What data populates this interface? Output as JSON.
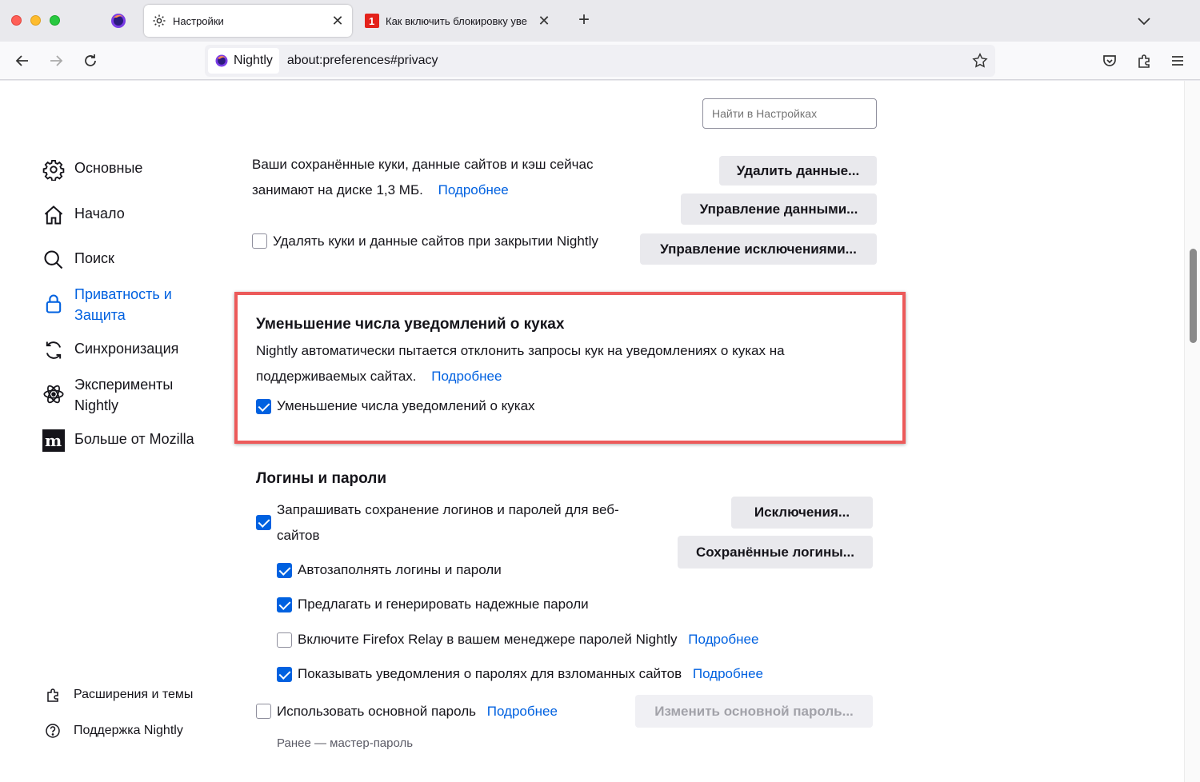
{
  "tabs": {
    "active_label": "Настройки",
    "inactive_label": "Как включить блокировку уве"
  },
  "urlbar": {
    "identity_label": "Nightly",
    "url": "about:preferences#privacy"
  },
  "search": {
    "placeholder": "Найти в Настройках"
  },
  "sidebar": {
    "items": [
      {
        "label": "Основные",
        "icon": "gear-icon"
      },
      {
        "label": "Начало",
        "icon": "home-icon"
      },
      {
        "label": "Поиск",
        "icon": "search-icon"
      },
      {
        "label": "Приватность и Защита",
        "icon": "lock-icon",
        "selected": true
      },
      {
        "label": "Синхронизация",
        "icon": "sync-icon"
      },
      {
        "label": "Эксперименты Nightly",
        "icon": "experiments-icon"
      },
      {
        "label": "Больше от Mozilla",
        "icon": "mozilla-icon"
      }
    ],
    "footer": {
      "extensions_label": "Расширения и темы",
      "support_label": "Поддержка Nightly"
    }
  },
  "cookies": {
    "usage_text_1": "Ваши сохранённые куки, данные сайтов и кэш сейчас",
    "usage_text_2": "занимают на диске 1,3 МБ.",
    "learn_more": "Подробнее",
    "delete_on_close_label": "Удалять куки и данные сайтов при закрытии Nightly",
    "delete_on_close_checked": false,
    "clear_data_button": "Удалить данные...",
    "manage_data_button": "Управление данными...",
    "manage_exceptions_button": "Управление исключениями..."
  },
  "cookie_banner": {
    "heading": "Уменьшение числа уведомлений о куках",
    "description_1": "Nightly автоматически пытается отклонить запросы кук на уведомлениях о куках на",
    "description_2": "поддерживаемых сайтах.",
    "learn_more": "Подробнее",
    "checkbox_label": "Уменьшение числа уведомлений о куках",
    "checked": true
  },
  "logins": {
    "heading": "Логины и пароли",
    "ask_save_label_1": "Запрашивать сохранение логинов и паролей для веб-",
    "ask_save_label_2": "сайтов",
    "ask_save_checked": true,
    "exceptions_button": "Исключения...",
    "saved_logins_button": "Сохранённые логины...",
    "autofill_label": "Автозаполнять логины и пароли",
    "autofill_checked": true,
    "generate_label": "Предлагать и генерировать надежные пароли",
    "generate_checked": true,
    "relay_label": "Включите Firefox Relay в вашем менеджере паролей Nightly",
    "relay_checked": false,
    "relay_learn_more": "Подробнее",
    "breach_label": "Показывать уведомления о паролях для взломанных сайтов",
    "breach_checked": true,
    "breach_learn_more": "Подробнее",
    "primary_label": "Использовать основной пароль",
    "primary_checked": false,
    "primary_learn_more": "Подробнее",
    "change_primary_button": "Изменить основной пароль...",
    "formerly_text": "Ранее — мастер-пароль"
  },
  "colors": {
    "accent": "#0061e0",
    "highlight_border": "#ec5a5a"
  }
}
